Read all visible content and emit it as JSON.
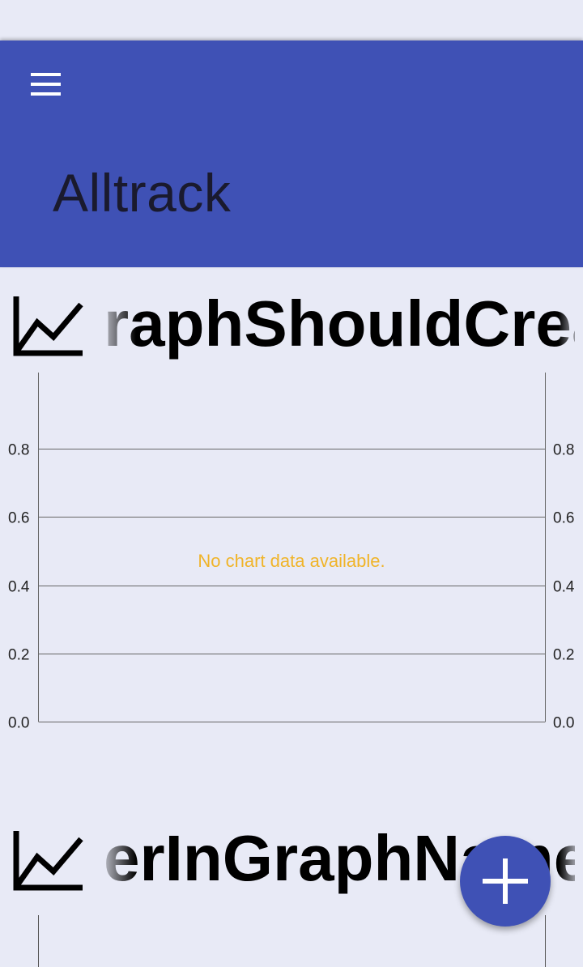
{
  "app": {
    "title": "Alltrack"
  },
  "icons": {
    "menu": "hamburger-menu-icon",
    "graph": "line-chart-icon",
    "add": "plus-icon"
  },
  "colors": {
    "primary": "#3f51b5",
    "background": "#e8eaf6",
    "empty_message": "#f0b429"
  },
  "graphs": [
    {
      "name_visible": "raphShouldCreat",
      "empty_message": "No chart data available.",
      "left_axis_ticks": [
        "0.8",
        "0.6",
        "0.4",
        "0.2",
        "0.0"
      ],
      "right_axis_ticks": [
        "0.8",
        "0.6",
        "0.4",
        "0.2",
        "0.0"
      ]
    },
    {
      "name_visible": "erInGraphNameI"
    }
  ],
  "chart_data": [
    {
      "type": "line",
      "title": "",
      "xlabel": "",
      "ylabel": "",
      "ylim": [
        0.0,
        1.0
      ],
      "y_ticks": [
        0.0,
        0.2,
        0.4,
        0.6,
        0.8
      ],
      "series": [],
      "grid": true,
      "note_text": "No chart data available."
    }
  ]
}
